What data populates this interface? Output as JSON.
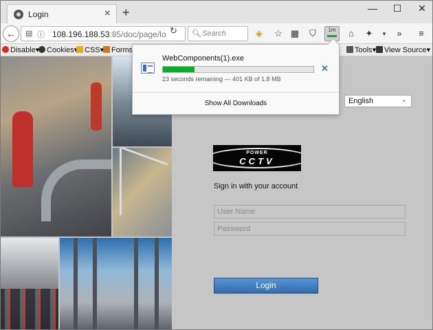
{
  "browser": {
    "tab": {
      "title": "Login"
    },
    "window_controls": {
      "minimize": "—",
      "maximize": "☐",
      "close": "✕"
    },
    "url": {
      "host": "108.196.188.53",
      "path": ":85/doc/page/lo"
    },
    "search": {
      "placeholder": "Search"
    },
    "download_badge": "1m"
  },
  "toolbar": {
    "items": [
      "Disable",
      "Cookies",
      "CSS",
      "Forms",
      "Tools",
      "View Source"
    ]
  },
  "downloads_panel": {
    "filename": "WebComponents(1).exe",
    "progress_fraction": 0.21,
    "status": "23 seconds remaining — 401 KB of 1.8 MB",
    "show_all": "Show All Downloads"
  },
  "login": {
    "language": "English",
    "logo_line1": "POWER",
    "logo_line2": "CCTV",
    "signin_heading": "Sign in with your account",
    "username_placeholder": "User Name",
    "password_placeholder": "Password",
    "login_button": "Login"
  }
}
